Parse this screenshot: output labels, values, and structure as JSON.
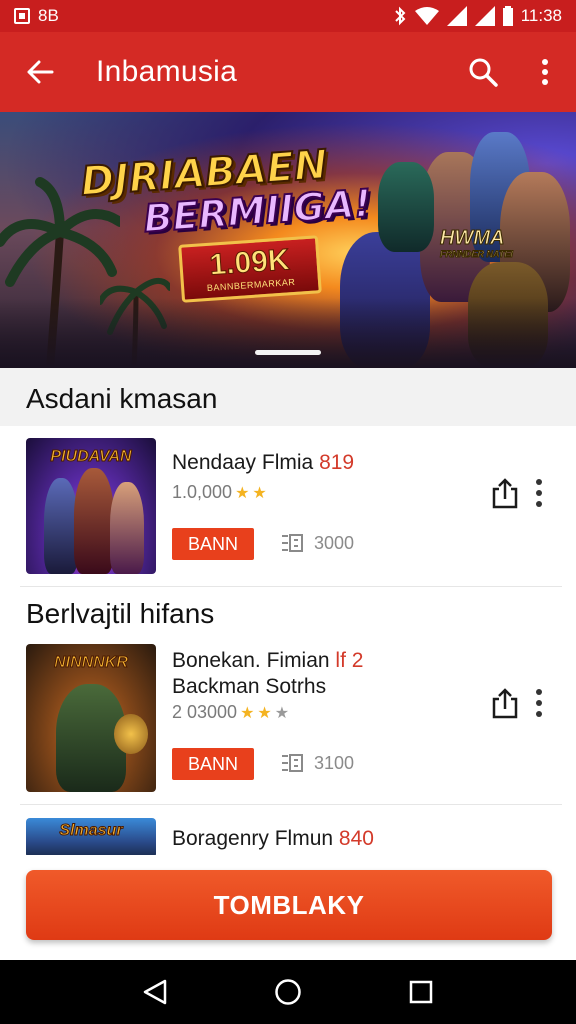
{
  "status_bar": {
    "left_text": "8B",
    "time": "11:38",
    "icons": [
      "notification-icon",
      "bluetooth-icon",
      "wifi-icon",
      "signal-icon",
      "signal-icon",
      "battery-icon"
    ]
  },
  "app_bar": {
    "title": "Inbamusia",
    "icons": [
      "back-arrow-icon",
      "search-icon",
      "more-vert-icon"
    ]
  },
  "banner": {
    "headline_line1": "DJRIABAEN",
    "headline_line2": "BERMIIGA!",
    "badge_big": "1.09K",
    "badge_small": "BANNBERMARKAR",
    "side_text": "HWMA",
    "side_sub": "FRNNDER NATEI"
  },
  "sections": [
    {
      "title": "Asdani kmasan"
    },
    {
      "title": "Berlvajtil hifans"
    }
  ],
  "games": [
    {
      "thumb_label": "PIUDAVAN",
      "name": "Nendaay Flmia ",
      "name_accent": "819",
      "name_line2": "",
      "rating_text": "1.0,000",
      "stars": [
        "star",
        "star"
      ],
      "button_label": "BANN",
      "downloads": "3000"
    },
    {
      "thumb_label": "NINNNKR",
      "name": "Bonekan. Fimian ",
      "name_accent": "lf 2",
      "name_line2": "Backman Sotrhs",
      "rating_text": "2 03000",
      "stars": [
        "star",
        "star",
        "grey"
      ],
      "button_label": "BANN",
      "downloads": "3100"
    },
    {
      "thumb_label": "Slmasur",
      "name": "Boragenry Flmun ",
      "name_accent": "840",
      "name_line2": ""
    }
  ],
  "cta": {
    "label": "TOMBLAKY"
  },
  "nav_bar": {
    "icons": [
      "back-triangle-icon",
      "home-circle-icon",
      "recents-square-icon"
    ]
  },
  "colors": {
    "primary": "#d42a25",
    "status_bar": "#c81e1e",
    "accent_button": "#e8401c",
    "star": "#f4b321"
  }
}
